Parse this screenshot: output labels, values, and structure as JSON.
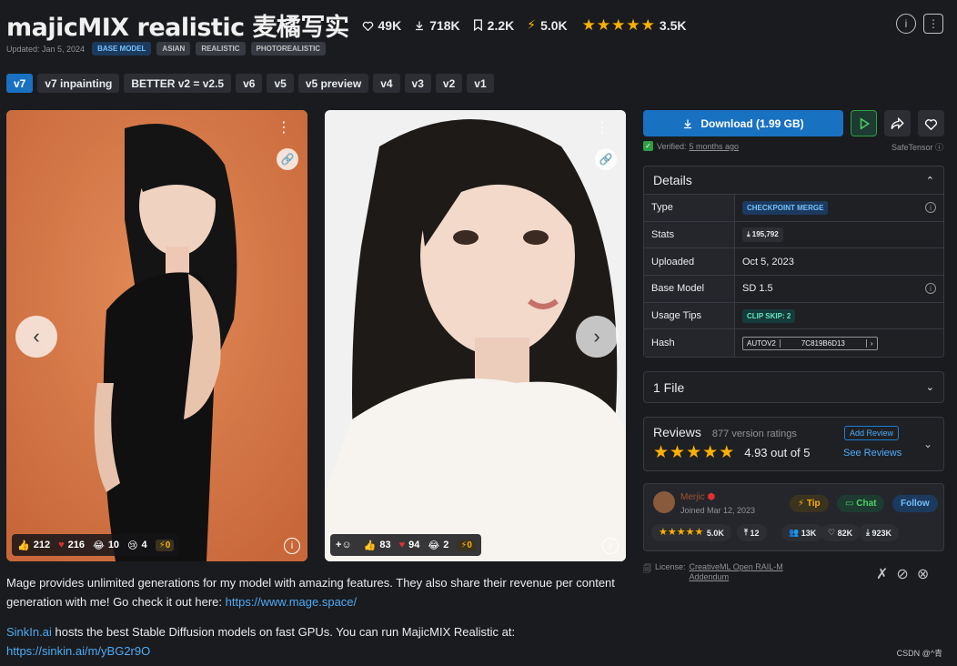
{
  "header": {
    "title": "majicMIX realistic 麦橘写实",
    "stats": {
      "likes": "49K",
      "downloads": "718K",
      "bookmarks": "2.2K",
      "buzz": "5.0K",
      "rating_count": "3.5K"
    },
    "rating_stars": 5
  },
  "meta": {
    "updated": "Updated: Jan 5, 2024",
    "badges": [
      "BASE MODEL",
      "ASIAN",
      "REALISTIC",
      "PHOTOREALISTIC"
    ]
  },
  "versions": [
    "v7",
    "v7 inpainting",
    "BETTER v2 = v2.5",
    "v6",
    "v5",
    "v5 preview",
    "v4",
    "v3",
    "v2",
    "v1"
  ],
  "gallery": {
    "image1": {
      "thumbs_up": "212",
      "hearts": "216",
      "laugh": "10",
      "sad": "4",
      "buzz": "0"
    },
    "image2": {
      "hearts_smile": "83",
      "hearts": "94",
      "laugh": "2",
      "buzz": "0"
    }
  },
  "download": {
    "label": "Download (1.99 GB)",
    "verified_label": "Verified:",
    "verified_time": "5 months ago",
    "format": "SafeTensor"
  },
  "details": {
    "header": "Details",
    "rows": [
      {
        "label": "Type",
        "value": "CHECKPOINT MERGE"
      },
      {
        "label": "Stats",
        "value": "195,792"
      },
      {
        "label": "Uploaded",
        "value": "Oct 5, 2023"
      },
      {
        "label": "Base Model",
        "value": "SD 1.5"
      },
      {
        "label": "Usage Tips",
        "value": "CLIP SKIP: 2"
      },
      {
        "label": "Hash",
        "value": "AUTOV2",
        "hash": "7C819B6D13"
      }
    ]
  },
  "files": {
    "label": "1 File"
  },
  "reviews": {
    "title": "Reviews",
    "count": "877 version ratings",
    "score": "4.93 out of 5",
    "add_label": "Add Review",
    "see_label": "See Reviews"
  },
  "creator": {
    "name": "Merjic",
    "joined": "Joined Mar 12, 2023",
    "tip": "Tip",
    "chat": "Chat",
    "follow": "Follow",
    "rating": "5.0K",
    "uploads": "12",
    "followers": "13K",
    "likes": "82K",
    "downloads": "923K"
  },
  "license": {
    "prefix": "License:",
    "line1": "CreativeML Open RAIL-M",
    "line2": "Addendum"
  },
  "description": {
    "p1_text": "Mage provides unlimited generations for my model with amazing features. They also share their revenue per content generation with me! Go check it out here: ",
    "p1_link": "https://www.mage.space/",
    "p2_link1": "SinkIn.ai",
    "p2_text": " hosts the best Stable Diffusion models on fast GPUs. You can run MajicMIX Realistic at:",
    "p2_link2": "https://sinkin.ai/m/yBG2r9O"
  },
  "watermark": "CSDN @^青"
}
